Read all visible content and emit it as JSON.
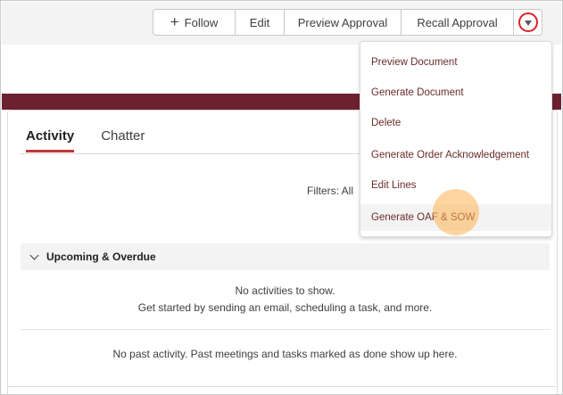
{
  "header": {
    "buttons": {
      "follow": "Follow",
      "edit": "Edit",
      "preview_approval": "Preview Approval",
      "recall_approval": "Recall Approval"
    }
  },
  "dropdown": {
    "items": [
      "Preview Document",
      "Generate Document",
      "Delete",
      "Generate Order Acknowledgement",
      "Edit Lines",
      "Generate OAF & SOW"
    ],
    "highlighted": "Generate OAF & SOW"
  },
  "tabs": [
    {
      "label": "Activity",
      "active": true
    },
    {
      "label": "Chatter",
      "active": false
    }
  ],
  "filters": {
    "label": "Filters: All"
  },
  "upcoming": {
    "title": "Upcoming & Overdue",
    "empty_line1": "No activities to show.",
    "empty_line2": "Get started by sending an email, scheduling a task, and more."
  },
  "past": {
    "empty": "No past activity. Past meetings and tasks marked as done show up here."
  },
  "colors": {
    "accent_maroon": "#6d2130",
    "active_tab_underline": "#c23934",
    "menu_ring": "#d8232a",
    "menu_text": "#6b2a2a",
    "cursor_highlight": "#ffb250"
  },
  "icons": {
    "follow": "plus-icon",
    "menu": "chevron-down-icon",
    "section": "chevron-down-icon"
  }
}
